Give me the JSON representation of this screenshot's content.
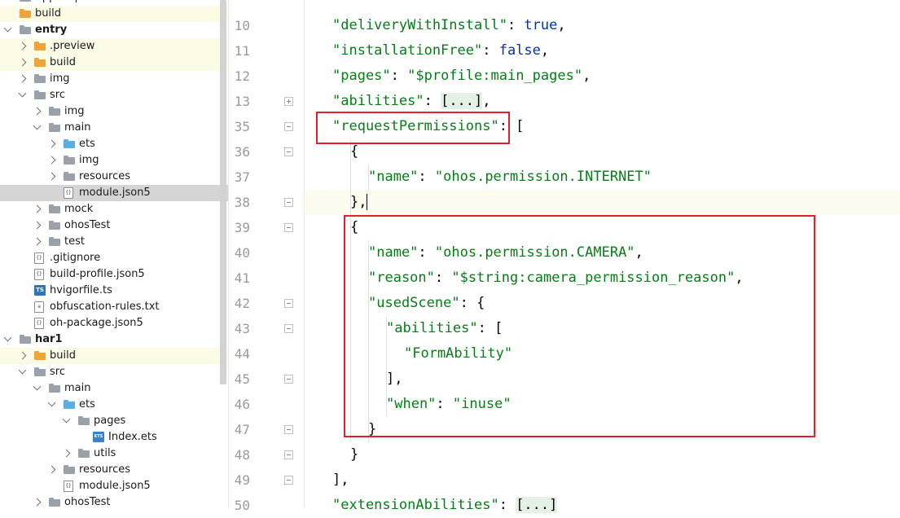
{
  "project_tree": {
    "items": [
      {
        "label": "AppScope",
        "depth": 0,
        "type": "folder-grey",
        "expand": "open",
        "bold": false
      },
      {
        "label": "build",
        "depth": 0,
        "type": "folder-orange",
        "expand": "none",
        "bold": false
      },
      {
        "label": "entry",
        "depth": 0,
        "type": "module",
        "expand": "open",
        "bold": true
      },
      {
        "label": ".preview",
        "depth": 1,
        "type": "folder-orange",
        "expand": "closed",
        "bold": false
      },
      {
        "label": "build",
        "depth": 1,
        "type": "folder-orange",
        "expand": "closed",
        "bold": false
      },
      {
        "label": "img",
        "depth": 1,
        "type": "folder-grey",
        "expand": "closed",
        "bold": false
      },
      {
        "label": "src",
        "depth": 1,
        "type": "folder-grey",
        "expand": "open",
        "bold": false
      },
      {
        "label": "img",
        "depth": 2,
        "type": "folder-grey",
        "expand": "closed",
        "bold": false
      },
      {
        "label": "main",
        "depth": 2,
        "type": "folder-grey",
        "expand": "open",
        "bold": false
      },
      {
        "label": "ets",
        "depth": 3,
        "type": "folder-blue",
        "expand": "closed",
        "bold": false
      },
      {
        "label": "img",
        "depth": 3,
        "type": "folder-grey",
        "expand": "closed",
        "bold": false
      },
      {
        "label": "resources",
        "depth": 3,
        "type": "folder-grey",
        "expand": "closed",
        "bold": false
      },
      {
        "label": "module.json5",
        "depth": 3,
        "type": "file-json",
        "expand": "none",
        "bold": false
      },
      {
        "label": "mock",
        "depth": 2,
        "type": "folder-grey",
        "expand": "closed",
        "bold": false
      },
      {
        "label": "ohosTest",
        "depth": 2,
        "type": "folder-grey",
        "expand": "closed",
        "bold": false
      },
      {
        "label": "test",
        "depth": 2,
        "type": "folder-grey",
        "expand": "closed",
        "bold": false
      },
      {
        "label": ".gitignore",
        "depth": 1,
        "type": "file-json",
        "expand": "none",
        "bold": false
      },
      {
        "label": "build-profile.json5",
        "depth": 1,
        "type": "file-json",
        "expand": "none",
        "bold": false
      },
      {
        "label": "hvigorfile.ts",
        "depth": 1,
        "type": "file-ts",
        "expand": "none",
        "bold": false
      },
      {
        "label": "obfuscation-rules.txt",
        "depth": 1,
        "type": "file-txt",
        "expand": "none",
        "bold": false
      },
      {
        "label": "oh-package.json5",
        "depth": 1,
        "type": "file-json",
        "expand": "none",
        "bold": false
      },
      {
        "label": "har1",
        "depth": 0,
        "type": "module",
        "expand": "open",
        "bold": true
      },
      {
        "label": "build",
        "depth": 1,
        "type": "folder-orange",
        "expand": "closed",
        "bold": false
      },
      {
        "label": "src",
        "depth": 1,
        "type": "folder-grey",
        "expand": "open",
        "bold": false
      },
      {
        "label": "main",
        "depth": 2,
        "type": "folder-grey",
        "expand": "open",
        "bold": false
      },
      {
        "label": "ets",
        "depth": 3,
        "type": "folder-blue",
        "expand": "open",
        "bold": false
      },
      {
        "label": "pages",
        "depth": 4,
        "type": "folder-grey",
        "expand": "open",
        "bold": false
      },
      {
        "label": "Index.ets",
        "depth": 5,
        "type": "file-ets",
        "expand": "none",
        "bold": false
      },
      {
        "label": "utils",
        "depth": 4,
        "type": "folder-grey",
        "expand": "closed",
        "bold": false
      },
      {
        "label": "resources",
        "depth": 3,
        "type": "folder-grey",
        "expand": "closed",
        "bold": false
      },
      {
        "label": "module.json5",
        "depth": 3,
        "type": "file-json",
        "expand": "none",
        "bold": false
      },
      {
        "label": "ohosTest",
        "depth": 2,
        "type": "folder-grey",
        "expand": "closed",
        "bold": false
      }
    ],
    "selected": "module.json5"
  },
  "editor": {
    "lines": [
      {
        "num": "10",
        "fold": "",
        "tokens": [
          [
            "s",
            "\"deliveryWithInstall\""
          ],
          [
            "p",
            ": "
          ],
          [
            "b",
            "true"
          ],
          [
            "p",
            ","
          ]
        ],
        "indent": 1
      },
      {
        "num": "11",
        "fold": "",
        "tokens": [
          [
            "s",
            "\"installationFree\""
          ],
          [
            "p",
            ": "
          ],
          [
            "b",
            "false"
          ],
          [
            "p",
            ","
          ]
        ],
        "indent": 1
      },
      {
        "num": "12",
        "fold": "",
        "tokens": [
          [
            "s",
            "\"pages\""
          ],
          [
            "p",
            ": "
          ],
          [
            "s",
            "\"$profile:main_pages\""
          ],
          [
            "p",
            ","
          ]
        ],
        "indent": 1
      },
      {
        "num": "13",
        "fold": "plus",
        "tokens": [
          [
            "s",
            "\"abilities\""
          ],
          [
            "p",
            ": "
          ],
          [
            "fb",
            "[...]"
          ],
          [
            "p",
            ","
          ]
        ],
        "indent": 1
      },
      {
        "num": "35",
        "fold": "minus",
        "tokens": [
          [
            "s",
            "\"requestPermissions\""
          ],
          [
            "p",
            ": ["
          ]
        ],
        "indent": 1
      },
      {
        "num": "36",
        "fold": "minus",
        "tokens": [
          [
            "p",
            "{"
          ]
        ],
        "indent": 2
      },
      {
        "num": "37",
        "fold": "",
        "tokens": [
          [
            "s",
            "\"name\""
          ],
          [
            "p",
            ": "
          ],
          [
            "s",
            "\"ohos.permission.INTERNET\""
          ]
        ],
        "indent": 3
      },
      {
        "num": "38",
        "fold": "minus",
        "tokens": [
          [
            "p",
            "},"
          ],
          [
            "caret",
            ""
          ]
        ],
        "indent": 2,
        "current": true
      },
      {
        "num": "39",
        "fold": "minus",
        "tokens": [
          [
            "p",
            "{"
          ]
        ],
        "indent": 2
      },
      {
        "num": "40",
        "fold": "",
        "tokens": [
          [
            "s",
            "\"name\""
          ],
          [
            "p",
            ": "
          ],
          [
            "s",
            "\"ohos.permission.CAMERA\""
          ],
          [
            "p",
            ","
          ]
        ],
        "indent": 3
      },
      {
        "num": "41",
        "fold": "",
        "tokens": [
          [
            "s",
            "\"reason\""
          ],
          [
            "p",
            ": "
          ],
          [
            "s",
            "\"$string:camera_permission_reason\""
          ],
          [
            "p",
            ","
          ]
        ],
        "indent": 3
      },
      {
        "num": "42",
        "fold": "minus",
        "tokens": [
          [
            "s",
            "\"usedScene\""
          ],
          [
            "p",
            ": {"
          ]
        ],
        "indent": 3
      },
      {
        "num": "43",
        "fold": "minus",
        "tokens": [
          [
            "s",
            "\"abilities\""
          ],
          [
            "p",
            ": ["
          ]
        ],
        "indent": 4
      },
      {
        "num": "44",
        "fold": "",
        "tokens": [
          [
            "s",
            "\"FormAbility\""
          ]
        ],
        "indent": 5
      },
      {
        "num": "45",
        "fold": "minus",
        "tokens": [
          [
            "p",
            "],"
          ]
        ],
        "indent": 4
      },
      {
        "num": "46",
        "fold": "",
        "tokens": [
          [
            "s",
            "\"when\""
          ],
          [
            "p",
            ": "
          ],
          [
            "s",
            "\"inuse\""
          ]
        ],
        "indent": 4
      },
      {
        "num": "47",
        "fold": "minus",
        "tokens": [
          [
            "p",
            "}"
          ]
        ],
        "indent": 3
      },
      {
        "num": "48",
        "fold": "minus",
        "tokens": [
          [
            "p",
            "}"
          ]
        ],
        "indent": 2
      },
      {
        "num": "49",
        "fold": "minus",
        "tokens": [
          [
            "p",
            "],"
          ]
        ],
        "indent": 1
      },
      {
        "num": "50",
        "fold": "",
        "tokens": [
          [
            "s",
            "\"extensionAbilities\""
          ],
          [
            "p",
            ": "
          ],
          [
            "fb",
            "[...]"
          ]
        ],
        "indent": 1
      }
    ]
  },
  "colors": {
    "string": "#067d17",
    "keyword": "#0033b3",
    "annotation_box": "#e0202a"
  }
}
